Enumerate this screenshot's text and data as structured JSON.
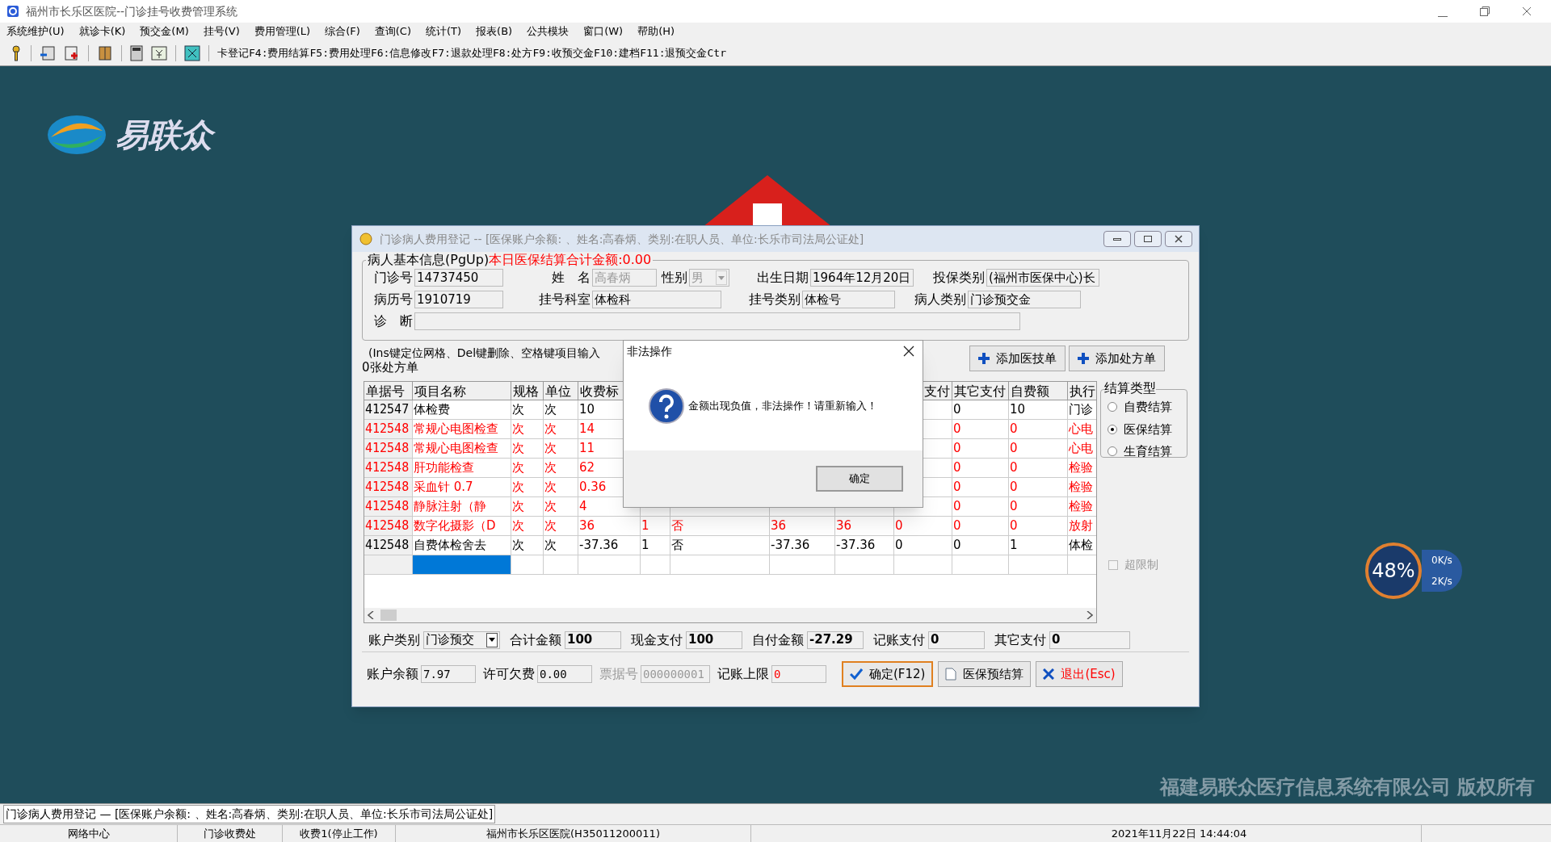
{
  "app_title": "福州市长乐区医院--门诊挂号收费管理系统",
  "menu": [
    "系统维护(U)",
    "就诊卡(K)",
    "预交金(M)",
    "挂号(V)",
    "费用管理(L)",
    "综合(F)",
    "查询(C)",
    "统计(T)",
    "报表(B)",
    "公共模块",
    "窗口(W)",
    "帮助(H)"
  ],
  "toolbar": {
    "shortcuts": "卡登记F4:费用结算F5:费用处理F6:信息修改F7:退款处理F8:处方F9:收预交金F10:建档F11:退预交金Ctr"
  },
  "desktop": {
    "logo_text": "易联众",
    "copyright": "福建易联众医疗信息系统有限公司 版权所有",
    "meter": {
      "percent": "48%",
      "upload": "0K/s",
      "download": "2K/s"
    }
  },
  "dialog": {
    "title": "门诊病人费用登记 -- [医保账户余额: 、姓名:高春炳、类别:在职人员、单位:长乐市司法局公证处]",
    "group_label": "病人基本信息(PgUp)",
    "daily_total": "本日医保结算合计金额:0.00",
    "field_rows": [
      [
        {
          "label": "门诊号",
          "value": "14737450",
          "disabled": false
        },
        {
          "label": "姓　名",
          "value": "高春炳",
          "disabled": true
        },
        {
          "label": "性别",
          "value": "男",
          "disabled": true,
          "kind": "dropdown"
        },
        {
          "label": "出生日期",
          "value": "1964年12月20日",
          "disabled": false
        },
        {
          "label": "投保类别",
          "value": "(福州市医保中心)长",
          "disabled": false
        }
      ],
      [
        {
          "label": "病历号",
          "value": "1910719",
          "disabled": false
        },
        {
          "label": "挂号科室",
          "value": "体检科",
          "disabled": false
        },
        {
          "label": "挂号类别",
          "value": "体检号",
          "disabled": false
        },
        {
          "label": "病人类别",
          "value": "门诊预交金",
          "disabled": false
        }
      ],
      [
        {
          "label": "诊　断"
        }
      ]
    ],
    "hint": "(Ins键定位网格、Del键删除、空格键项目输入",
    "prescription_count": "0张处方单",
    "add_buttons": [
      "添加医技单",
      "添加处方单"
    ],
    "table": {
      "columns": [
        "单据号",
        "项目名称",
        "规格",
        "单位",
        "收费标",
        null,
        null,
        null,
        null,
        "支付",
        "其它支付",
        "自费额",
        "执行"
      ],
      "rows": [
        {
          "kind": "item",
          "flagged": false,
          "cells": [
            "412547",
            "体检费",
            "次",
            "次",
            "10",
            null,
            null,
            null,
            null,
            null,
            "0",
            "10",
            "门诊"
          ]
        },
        {
          "kind": "item",
          "flagged": true,
          "cells": [
            "412548",
            "常规心电图检查",
            "次",
            "次",
            "14",
            null,
            null,
            null,
            null,
            null,
            "0",
            "0",
            "心电"
          ]
        },
        {
          "kind": "item",
          "flagged": true,
          "cells": [
            "412548",
            "常规心电图检查",
            "次",
            "次",
            "11",
            null,
            null,
            null,
            null,
            null,
            "0",
            "0",
            "心电"
          ]
        },
        {
          "kind": "item",
          "flagged": true,
          "cells": [
            "412548",
            "肝功能检查",
            "次",
            "次",
            "62",
            null,
            null,
            null,
            null,
            null,
            "0",
            "0",
            "检验"
          ]
        },
        {
          "kind": "item",
          "flagged": true,
          "cells": [
            "412548",
            "采血针 0.7",
            "次",
            "次",
            "0.36",
            null,
            null,
            null,
            null,
            null,
            "0",
            "0",
            "检验"
          ]
        },
        {
          "kind": "item",
          "flagged": true,
          "cells": [
            "412548",
            "静脉注射（静",
            "次",
            "次",
            "4",
            null,
            null,
            null,
            null,
            null,
            "0",
            "0",
            "检验"
          ]
        },
        {
          "kind": "item",
          "flagged": true,
          "cells": [
            "412548",
            "数字化摄影（D",
            "次",
            "次",
            "36",
            "1",
            "否",
            "36",
            "36",
            "0",
            "0",
            "0",
            "放射"
          ]
        },
        {
          "kind": "item",
          "flagged": false,
          "cells": [
            "412548",
            "自费体检舍去",
            "次",
            "次",
            "-37.36",
            "1",
            "否",
            "-37.36",
            "-37.36",
            "0",
            "0",
            "1",
            "体检"
          ]
        },
        {
          "kind": "blank",
          "focused": true
        }
      ]
    },
    "settlement": {
      "title": "结算类型",
      "options": [
        {
          "label": "自费结算",
          "selected": false
        },
        {
          "label": "医保结算",
          "selected": true
        },
        {
          "label": "生育结算",
          "selected": false
        }
      ]
    },
    "limit_checkbox": {
      "label": "超限制",
      "checked": false,
      "disabled": true
    },
    "totals": [
      {
        "label": "账户类别",
        "value": "门诊预交",
        "kind": "dropdown"
      },
      {
        "label": "合计金额",
        "value": "100",
        "kind": "bold"
      },
      {
        "label": "现金支付",
        "value": "100",
        "kind": "bold"
      },
      {
        "label": "自付金额",
        "value": "-27.29",
        "kind": "bold"
      },
      {
        "label": "记账支付",
        "value": "0",
        "kind": "bold"
      },
      {
        "label": "其它支付",
        "value": "0",
        "kind": "bold"
      }
    ],
    "account": [
      {
        "label": "账户余额",
        "value": "7.97",
        "kind": "plain"
      },
      {
        "label": "许可欠费",
        "value": "0.00",
        "kind": "plain"
      },
      {
        "label": "票据号",
        "value": "000000001",
        "kind": "disabled"
      },
      {
        "label": "记账上限",
        "value": "0",
        "kind": "alert"
      }
    ],
    "actions": [
      {
        "label": "确定(F12)",
        "kind": "confirm",
        "focused": true
      },
      {
        "label": "医保预结算",
        "kind": "document",
        "focused": false
      },
      {
        "label": "退出(Esc)",
        "kind": "exit",
        "focused": false
      }
    ]
  },
  "alert": {
    "title": "非法操作",
    "message": "金额出现负值，非法操作！请重新输入！",
    "button": "确定"
  },
  "status_message": "门诊病人费用登记 — [医保账户余额: 、姓名:高春炳、类别:在职人员、单位:长乐市司法局公证处]",
  "status_cells": [
    "网络中心",
    "门诊收费处",
    "收费1(停止工作)",
    "福州市长乐区医院(H35011200011)",
    "2021年11月22日 14:44:04"
  ]
}
